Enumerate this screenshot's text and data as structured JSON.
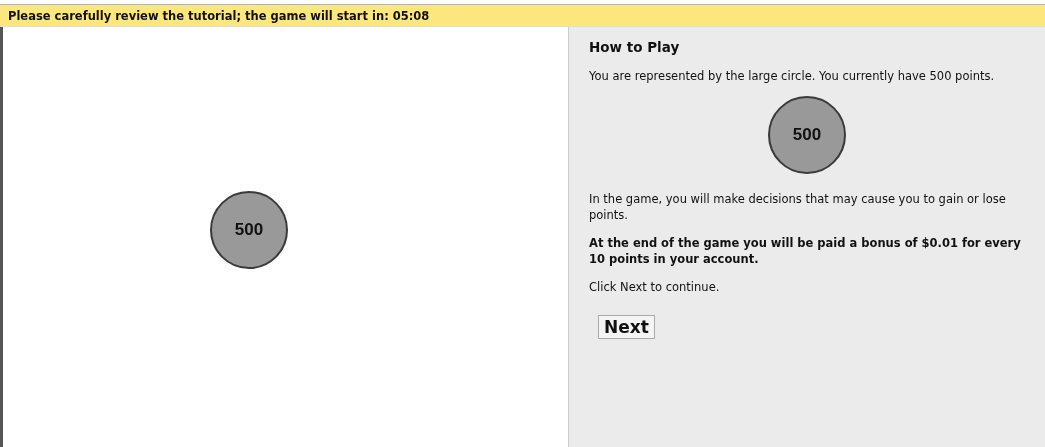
{
  "banner": {
    "text": "Please carefully review the tutorial; the game will start in: 05:08"
  },
  "game_canvas": {
    "player": {
      "points": "500"
    }
  },
  "instructions": {
    "title": "How to Play",
    "blocks": [
      {
        "kind": "text",
        "text": "You are represented by the large circle. You currently have 500 points."
      },
      {
        "kind": "circle",
        "text": "500"
      },
      {
        "kind": "text",
        "text": "In the game, you will make decisions that may cause you to gain or lose points."
      },
      {
        "kind": "bold",
        "text": "At the end of the game you will be paid a bonus of $0.01 for every 10 points in your account."
      },
      {
        "kind": "text",
        "text": "Click Next to continue."
      }
    ],
    "button": "Next"
  }
}
